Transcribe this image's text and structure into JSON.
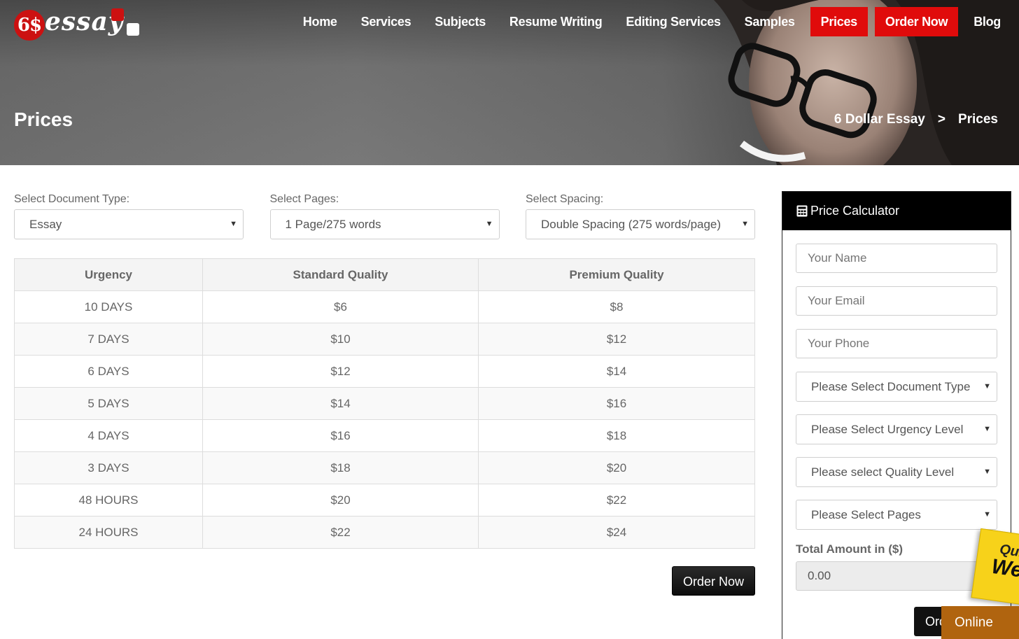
{
  "brand": {
    "logo_mark": "6$",
    "logo_word": "essay"
  },
  "nav": {
    "items": [
      {
        "label": "Home"
      },
      {
        "label": "Services"
      },
      {
        "label": "Subjects"
      },
      {
        "label": "Resume Writing"
      },
      {
        "label": "Editing Services"
      },
      {
        "label": "Samples"
      },
      {
        "label": "Prices",
        "active": true
      },
      {
        "label": "Order Now",
        "highlight": true
      },
      {
        "label": "Blog"
      }
    ]
  },
  "hero": {
    "title": "Prices",
    "breadcrumb": {
      "home": "6 Dollar Essay",
      "separator": ">",
      "current": "Prices"
    }
  },
  "filters": {
    "document_type": {
      "label": "Select Document Type:",
      "value": "Essay"
    },
    "pages": {
      "label": "Select Pages:",
      "value": "1 Page/275 words"
    },
    "spacing": {
      "label": "Select Spacing:",
      "value": "Double Spacing (275 words/page)"
    }
  },
  "price_table": {
    "headers": [
      "Urgency",
      "Standard Quality",
      "Premium Quality"
    ],
    "rows": [
      [
        "10 DAYS",
        "$6",
        "$8"
      ],
      [
        "7 DAYS",
        "$10",
        "$12"
      ],
      [
        "6 DAYS",
        "$12",
        "$14"
      ],
      [
        "5 DAYS",
        "$14",
        "$16"
      ],
      [
        "4 DAYS",
        "$16",
        "$18"
      ],
      [
        "3 DAYS",
        "$18",
        "$20"
      ],
      [
        "48 HOURS",
        "$20",
        "$22"
      ],
      [
        "24 HOURS",
        "$22",
        "$24"
      ]
    ]
  },
  "order_button": "Order Now",
  "calculator": {
    "title": "Price Calculator",
    "name_placeholder": "Your Name",
    "email_placeholder": "Your Email",
    "phone_placeholder": "Your Phone",
    "document_type": "Please Select Document Type",
    "urgency": "Please Select Urgency Level",
    "quality": "Please select Quality Level",
    "pages": "Please Select Pages",
    "total_label": "Total Amount in ($)",
    "total_value": "0.00",
    "order_label": "Order Now"
  },
  "widgets": {
    "sticky_line1": "Quic",
    "sticky_line2": "We",
    "online": "Online"
  },
  "colors": {
    "accent_red": "#e00b0b",
    "dark_button": "#141414",
    "online_badge": "#b0640f"
  }
}
